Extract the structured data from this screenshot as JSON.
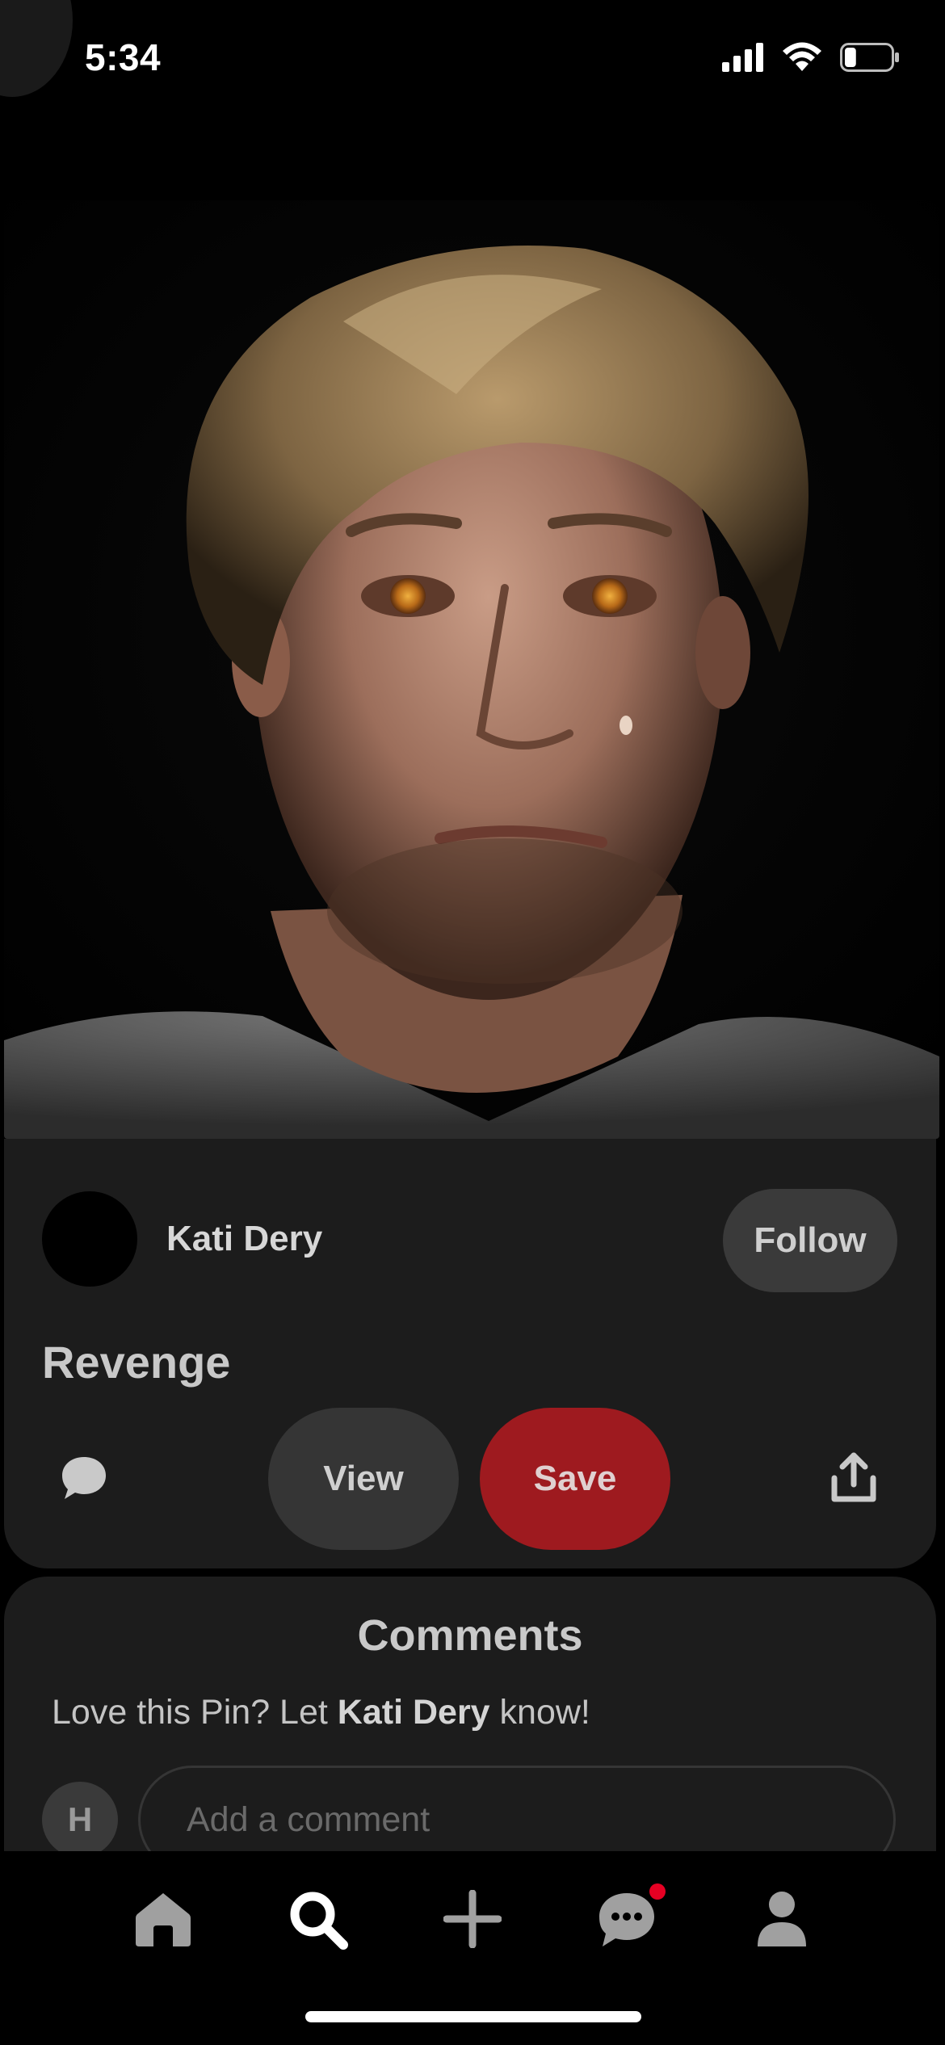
{
  "status_bar": {
    "time": "5:34",
    "battery_level": 0.25
  },
  "pin": {
    "author": "Kati Dery",
    "follow_label": "Follow",
    "title": "Revenge",
    "view_label": "View",
    "save_label": "Save",
    "image_alt_icon": "portrait-photo"
  },
  "comments": {
    "title": "Comments",
    "prompt_prefix": "Love this Pin? Let ",
    "prompt_name": "Kati Dery",
    "prompt_suffix": " know!",
    "user_initial": "H",
    "input_placeholder": "Add a comment"
  },
  "nav": {
    "items": [
      {
        "icon": "home-icon"
      },
      {
        "icon": "search-icon",
        "active": true
      },
      {
        "icon": "plus-icon"
      },
      {
        "icon": "chat-icon",
        "has_notification": true
      },
      {
        "icon": "profile-icon"
      }
    ]
  },
  "colors": {
    "save_button": "#9e1a1f",
    "notification": "#e60023",
    "card_background": "#1c1c1c"
  }
}
